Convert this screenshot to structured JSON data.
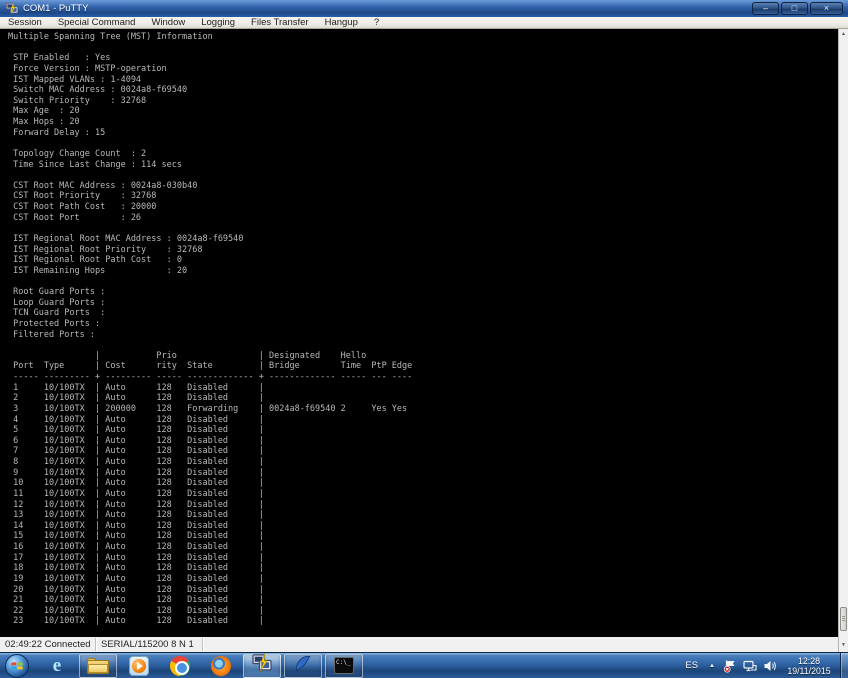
{
  "window": {
    "title": "COM1 - PuTTY",
    "controls": {
      "minimize": "–",
      "maximize": "□",
      "close": "×"
    }
  },
  "menu": {
    "items": [
      "Session",
      "Special Command",
      "Window",
      "Logging",
      "Files Transfer",
      "Hangup",
      "?"
    ]
  },
  "terminal": {
    "background": "#000000",
    "text_color": "#b9b9b9",
    "lines": [
      "Multiple Spanning Tree (MST) Information",
      "",
      " STP Enabled   : Yes",
      " Force Version : MSTP-operation",
      " IST Mapped VLANs : 1-4094",
      " Switch MAC Address : 0024a8-f69540",
      " Switch Priority    : 32768",
      " Max Age  : 20",
      " Max Hops : 20",
      " Forward Delay : 15",
      "",
      " Topology Change Count  : 2",
      " Time Since Last Change : 114 secs",
      "",
      " CST Root MAC Address : 0024a8-030b40",
      " CST Root Priority    : 32768",
      " CST Root Path Cost   : 20000",
      " CST Root Port        : 26",
      "",
      " IST Regional Root MAC Address : 0024a8-f69540",
      " IST Regional Root Priority    : 32768",
      " IST Regional Root Path Cost   : 0",
      " IST Remaining Hops            : 20",
      "",
      " Root Guard Ports :",
      " Loop Guard Ports :",
      " TCN Guard Ports  :",
      " Protected Ports :",
      " Filtered Ports :",
      "",
      "                 |           Prio                | Designated    Hello",
      " Port  Type      | Cost      rity  State         | Bridge        Time  PtP Edge",
      " ----- --------- + --------- ----- ------------- + ------------- ----- --- ----",
      " 1     10/100TX  | Auto      128   Disabled      |",
      " 2     10/100TX  | Auto      128   Disabled      |",
      " 3     10/100TX  | 200000    128   Forwarding    | 0024a8-f69540 2     Yes Yes",
      " 4     10/100TX  | Auto      128   Disabled      |",
      " 5     10/100TX  | Auto      128   Disabled      |",
      " 6     10/100TX  | Auto      128   Disabled      |",
      " 7     10/100TX  | Auto      128   Disabled      |",
      " 8     10/100TX  | Auto      128   Disabled      |",
      " 9     10/100TX  | Auto      128   Disabled      |",
      " 10    10/100TX  | Auto      128   Disabled      |",
      " 11    10/100TX  | Auto      128   Disabled      |",
      " 12    10/100TX  | Auto      128   Disabled      |",
      " 13    10/100TX  | Auto      128   Disabled      |",
      " 14    10/100TX  | Auto      128   Disabled      |",
      " 15    10/100TX  | Auto      128   Disabled      |",
      " 16    10/100TX  | Auto      128   Disabled      |",
      " 17    10/100TX  | Auto      128   Disabled      |",
      " 18    10/100TX  | Auto      128   Disabled      |",
      " 19    10/100TX  | Auto      128   Disabled      |",
      " 20    10/100TX  | Auto      128   Disabled      |",
      " 21    10/100TX  | Auto      128   Disabled      |",
      " 22    10/100TX  | Auto      128   Disabled      |",
      " 23    10/100TX  | Auto      128   Disabled      |"
    ],
    "mst_info": {
      "title": "Multiple Spanning Tree (MST) Information",
      "STP Enabled": "Yes",
      "Force Version": "MSTP-operation",
      "IST Mapped VLANs": "1-4094",
      "Switch MAC Address": "0024a8-f69540",
      "Switch Priority": "32768",
      "Max Age": "20",
      "Max Hops": "20",
      "Forward Delay": "15",
      "Topology Change Count": "2",
      "Time Since Last Change": "114 secs",
      "CST Root MAC Address": "0024a8-030b40",
      "CST Root Priority": "32768",
      "CST Root Path Cost": "20000",
      "CST Root Port": "26",
      "IST Regional Root MAC Address": "0024a8-f69540",
      "IST Regional Root Priority": "32768",
      "IST Regional Root Path Cost": "0",
      "IST Remaining Hops": "20",
      "Root Guard Ports": "",
      "Loop Guard Ports": "",
      "TCN Guard Ports": "",
      "Protected Ports": "",
      "Filtered Ports": ""
    },
    "port_table": {
      "columns": [
        "Port",
        "Type",
        "Cost",
        "Priority",
        "State",
        "Designated Bridge",
        "Hello Time",
        "PtP",
        "Edge"
      ],
      "rows": [
        [
          "1",
          "10/100TX",
          "Auto",
          "128",
          "Disabled",
          "",
          "",
          "",
          ""
        ],
        [
          "2",
          "10/100TX",
          "Auto",
          "128",
          "Disabled",
          "",
          "",
          "",
          ""
        ],
        [
          "3",
          "10/100TX",
          "200000",
          "128",
          "Forwarding",
          "0024a8-f69540",
          "2",
          "Yes",
          "Yes"
        ],
        [
          "4",
          "10/100TX",
          "Auto",
          "128",
          "Disabled",
          "",
          "",
          "",
          ""
        ],
        [
          "5",
          "10/100TX",
          "Auto",
          "128",
          "Disabled",
          "",
          "",
          "",
          ""
        ],
        [
          "6",
          "10/100TX",
          "Auto",
          "128",
          "Disabled",
          "",
          "",
          "",
          ""
        ],
        [
          "7",
          "10/100TX",
          "Auto",
          "128",
          "Disabled",
          "",
          "",
          "",
          ""
        ],
        [
          "8",
          "10/100TX",
          "Auto",
          "128",
          "Disabled",
          "",
          "",
          "",
          ""
        ],
        [
          "9",
          "10/100TX",
          "Auto",
          "128",
          "Disabled",
          "",
          "",
          "",
          ""
        ],
        [
          "10",
          "10/100TX",
          "Auto",
          "128",
          "Disabled",
          "",
          "",
          "",
          ""
        ],
        [
          "11",
          "10/100TX",
          "Auto",
          "128",
          "Disabled",
          "",
          "",
          "",
          ""
        ],
        [
          "12",
          "10/100TX",
          "Auto",
          "128",
          "Disabled",
          "",
          "",
          "",
          ""
        ],
        [
          "13",
          "10/100TX",
          "Auto",
          "128",
          "Disabled",
          "",
          "",
          "",
          ""
        ],
        [
          "14",
          "10/100TX",
          "Auto",
          "128",
          "Disabled",
          "",
          "",
          "",
          ""
        ],
        [
          "15",
          "10/100TX",
          "Auto",
          "128",
          "Disabled",
          "",
          "",
          "",
          ""
        ],
        [
          "16",
          "10/100TX",
          "Auto",
          "128",
          "Disabled",
          "",
          "",
          "",
          ""
        ],
        [
          "17",
          "10/100TX",
          "Auto",
          "128",
          "Disabled",
          "",
          "",
          "",
          ""
        ],
        [
          "18",
          "10/100TX",
          "Auto",
          "128",
          "Disabled",
          "",
          "",
          "",
          ""
        ],
        [
          "19",
          "10/100TX",
          "Auto",
          "128",
          "Disabled",
          "",
          "",
          "",
          ""
        ],
        [
          "20",
          "10/100TX",
          "Auto",
          "128",
          "Disabled",
          "",
          "",
          "",
          ""
        ],
        [
          "21",
          "10/100TX",
          "Auto",
          "128",
          "Disabled",
          "",
          "",
          "",
          ""
        ],
        [
          "22",
          "10/100TX",
          "Auto",
          "128",
          "Disabled",
          "",
          "",
          "",
          ""
        ],
        [
          "23",
          "10/100TX",
          "Auto",
          "128",
          "Disabled",
          "",
          "",
          "",
          ""
        ]
      ]
    }
  },
  "status_bar": {
    "left": "02:49:22 Connected",
    "right": "SERIAL/115200 8 N 1"
  },
  "scrollbar": {
    "up_glyph": "▲",
    "down_glyph": "▼"
  },
  "taskbar": {
    "apps": [
      {
        "name": "internet-explorer",
        "open": false,
        "active": false
      },
      {
        "name": "windows-explorer",
        "open": true,
        "active": false
      },
      {
        "name": "windows-media-player",
        "open": false,
        "active": false
      },
      {
        "name": "google-chrome",
        "open": false,
        "active": false
      },
      {
        "name": "firefox",
        "open": false,
        "active": false
      },
      {
        "name": "putty",
        "open": true,
        "active": true
      },
      {
        "name": "wireshark",
        "open": true,
        "active": false
      },
      {
        "name": "command-prompt",
        "open": true,
        "active": false
      }
    ],
    "cmd_icon_text": "C:\\_",
    "tray": {
      "language": "ES",
      "hidden_icons_glyph": "▲",
      "time": "12:28",
      "date": "19/11/2015"
    }
  },
  "colors": {
    "titlebar_blue": "#2a5ea6",
    "taskbar_blue": "#2e62a4",
    "terminal_bg": "#000000",
    "terminal_text": "#b9b9b9",
    "statusbar_bg": "#f0f0f0"
  }
}
